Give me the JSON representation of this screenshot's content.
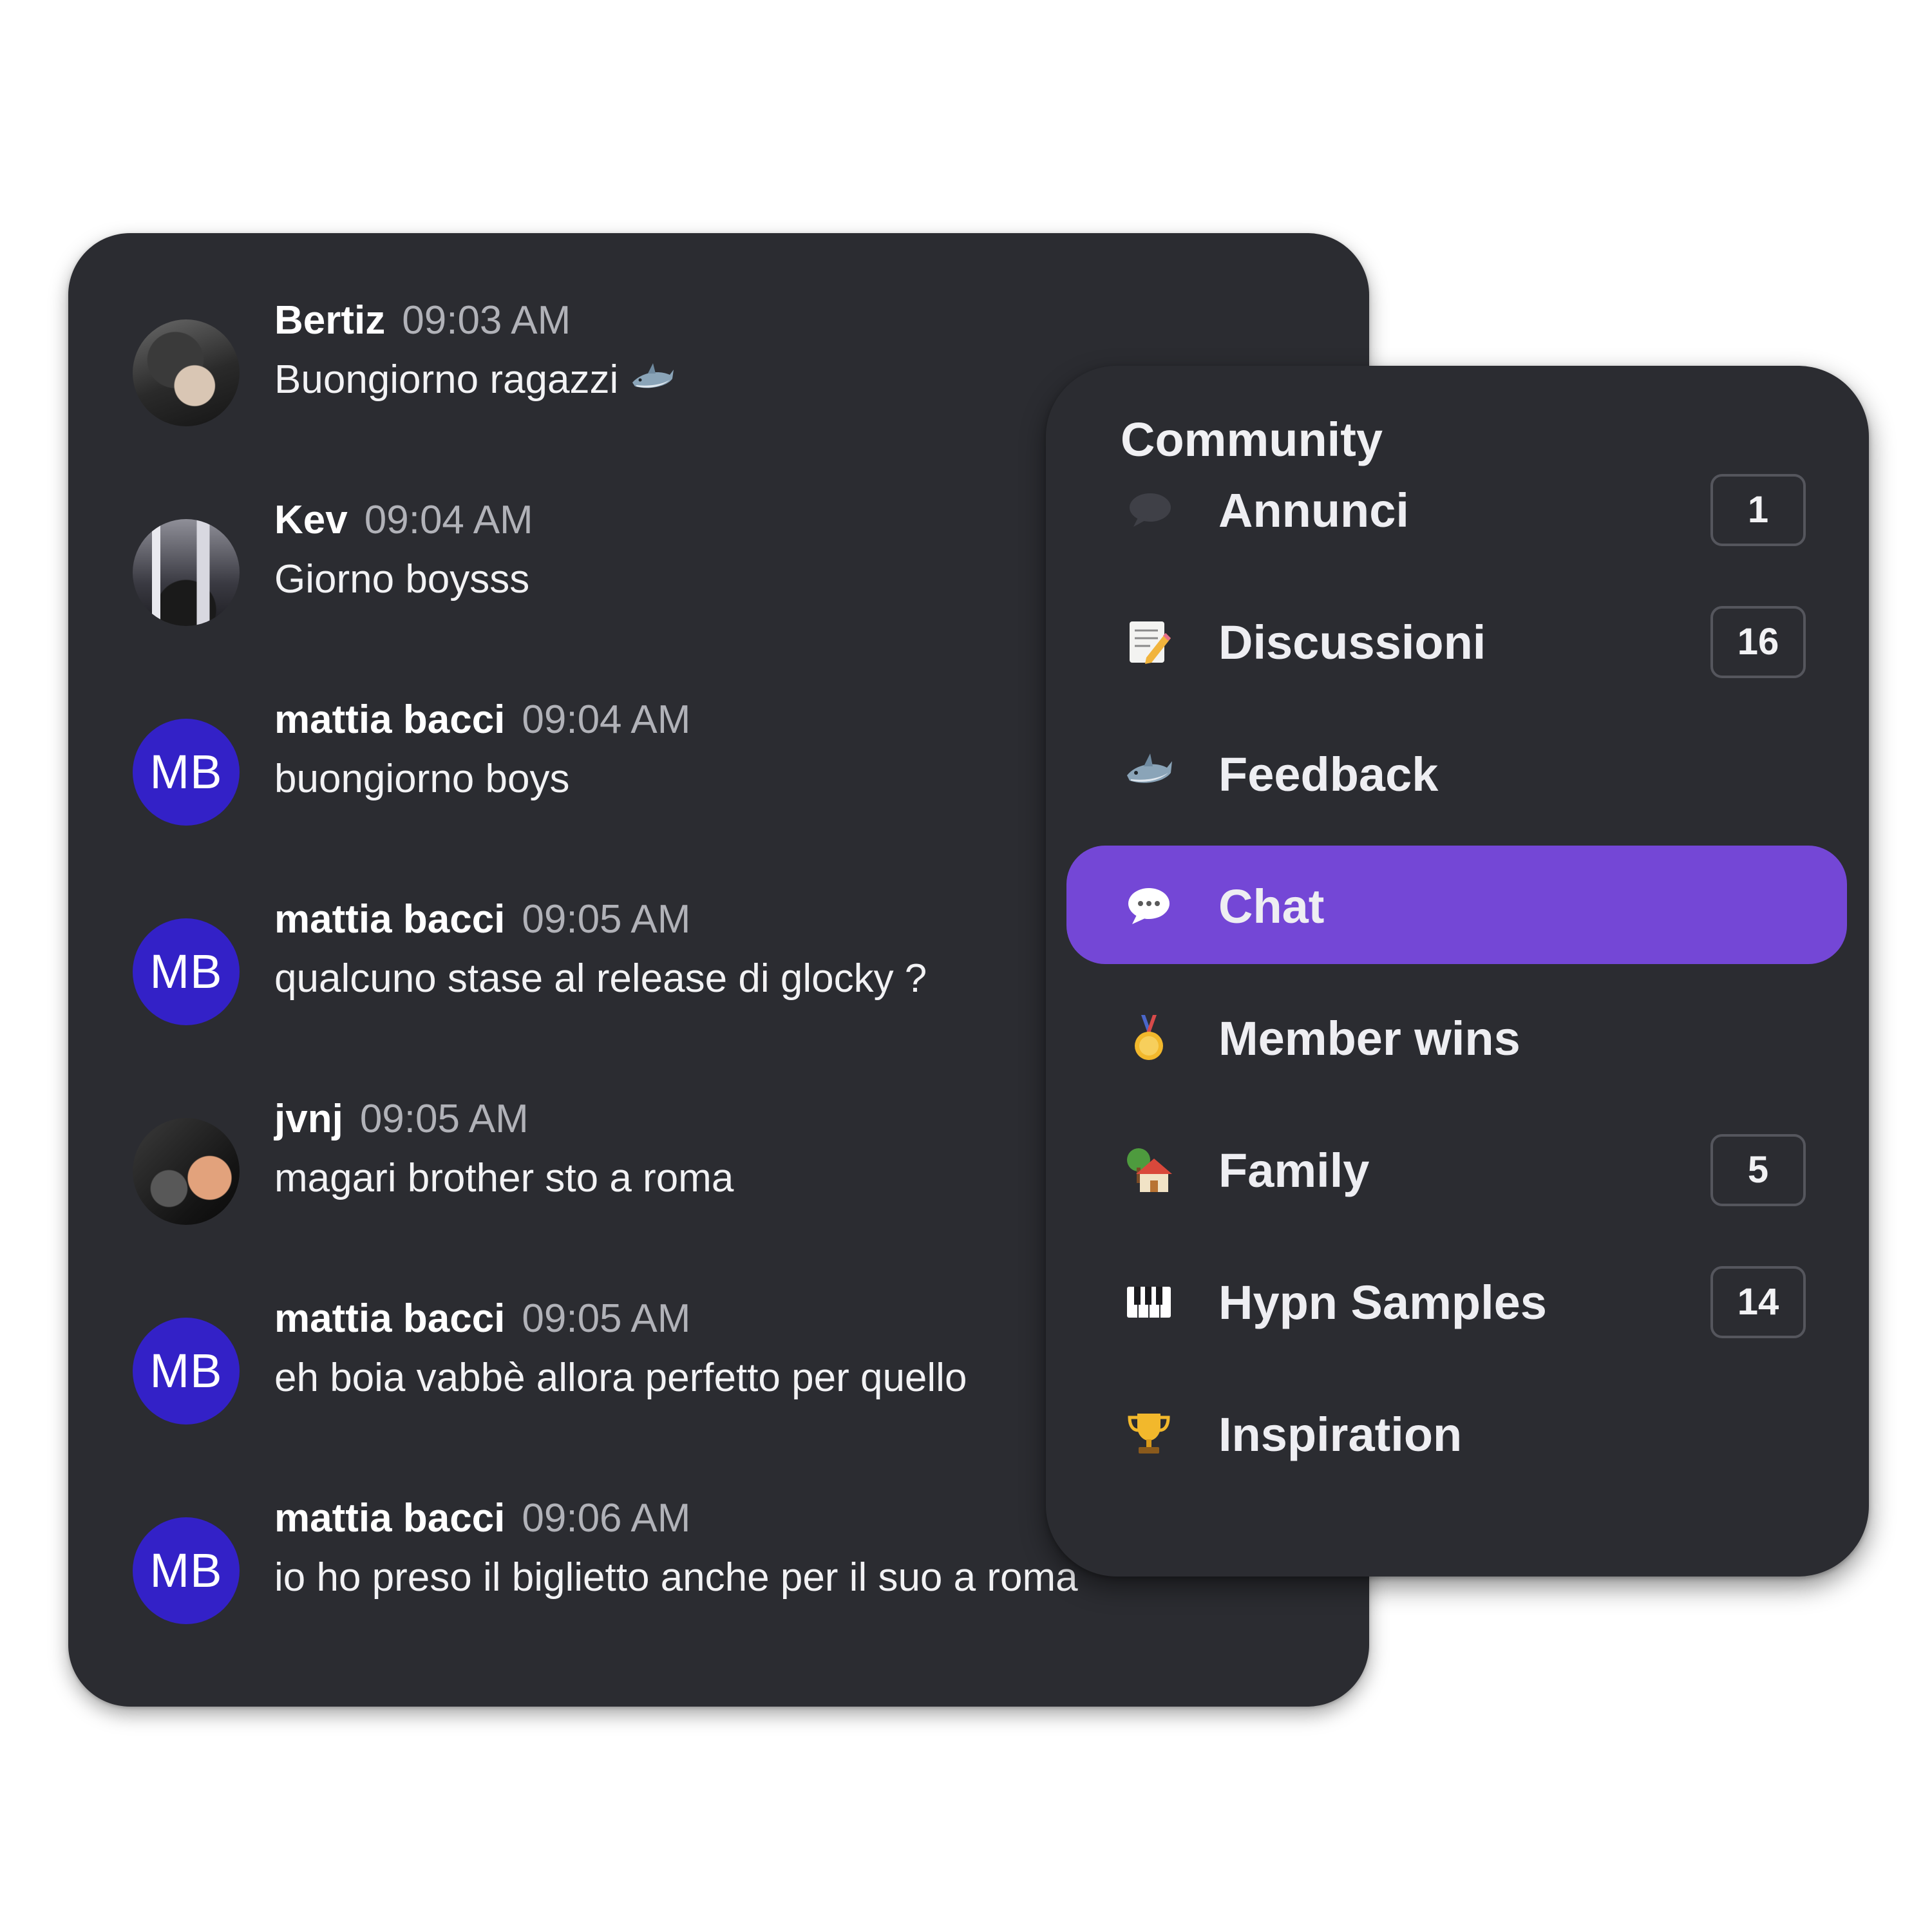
{
  "chat": {
    "messages": [
      {
        "author": "Bertiz",
        "time": "09:03 AM",
        "text": "Buongiorno ragazzi",
        "avatar": "photo",
        "emoji": "shark"
      },
      {
        "author": "Kev",
        "time": "09:04 AM",
        "text": "Giorno boysss",
        "avatar": "photo"
      },
      {
        "author": "mattia bacci",
        "time": "09:04 AM",
        "text": "buongiorno boys",
        "avatar": "initials",
        "initials": "MB"
      },
      {
        "author": "mattia bacci",
        "time": "09:05 AM",
        "text": "qualcuno stase al release di glocky ?",
        "avatar": "initials",
        "initials": "MB"
      },
      {
        "author": "jvnj",
        "time": "09:05 AM",
        "text": "magari brother sto a roma",
        "avatar": "photo"
      },
      {
        "author": "mattia bacci",
        "time": "09:05 AM",
        "text": "eh boia vabbè allora perfetto per quello",
        "avatar": "initials",
        "initials": "MB"
      },
      {
        "author": "mattia bacci",
        "time": "09:06 AM",
        "text": "io ho preso il biglietto anche per il suo a roma",
        "avatar": "initials",
        "initials": "MB"
      }
    ]
  },
  "community": {
    "title": "Community",
    "items": [
      {
        "label": "Annunci",
        "icon": "speech-bubble-icon",
        "badge": "1"
      },
      {
        "label": "Discussioni",
        "icon": "memo-icon",
        "badge": "16"
      },
      {
        "label": "Feedback",
        "icon": "shark-icon"
      },
      {
        "label": "Chat",
        "icon": "chat-bubble-icon",
        "active": true
      },
      {
        "label": "Member wins",
        "icon": "medal-icon"
      },
      {
        "label": "Family",
        "icon": "house-icon",
        "badge": "5"
      },
      {
        "label": "Hypn Samples",
        "icon": "piano-keys-icon",
        "badge": "14"
      },
      {
        "label": "Inspiration",
        "icon": "trophy-icon"
      }
    ]
  },
  "colors": {
    "card_bg": "#2b2c31",
    "accent": "#7447d6",
    "avatar_initials_bg": "#3321c7",
    "timestamp": "#b1b2b8",
    "badge_border": "#55565d"
  }
}
